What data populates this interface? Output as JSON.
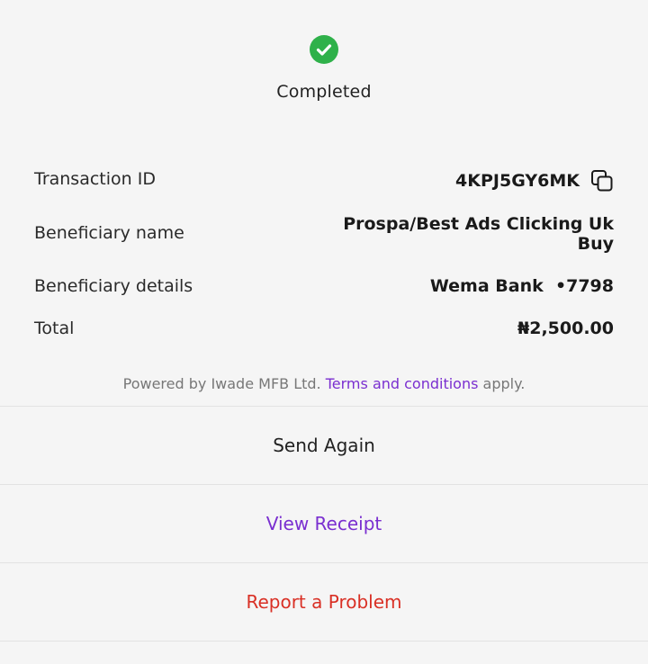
{
  "status": {
    "text": "Completed",
    "icon": "check-circle-icon",
    "color": "#2fb14a"
  },
  "details": {
    "transaction_id": {
      "label": "Transaction ID",
      "value": "4KPJ5GY6MK",
      "icon": "copy-icon"
    },
    "beneficiary_name": {
      "label": "Beneficiary name",
      "value": "Prospa/Best Ads Clicking Uk Buy"
    },
    "beneficiary_details": {
      "label": "Beneficiary details",
      "value": "Wema Bank  •7798"
    },
    "total": {
      "label": "Total",
      "value": "₦2,500.00"
    }
  },
  "footer": {
    "powered_prefix": "Powered by Iwade MFB Ltd. ",
    "terms_link": "Terms and conditions",
    "powered_suffix": " apply."
  },
  "actions": {
    "send_again": "Send Again",
    "view_receipt": "View Receipt",
    "report_problem": "Report a Problem"
  },
  "colors": {
    "accent_purple": "#7a2fd0",
    "danger_red": "#d93025",
    "success_green": "#2fb14a",
    "background": "#f5f5f5"
  }
}
